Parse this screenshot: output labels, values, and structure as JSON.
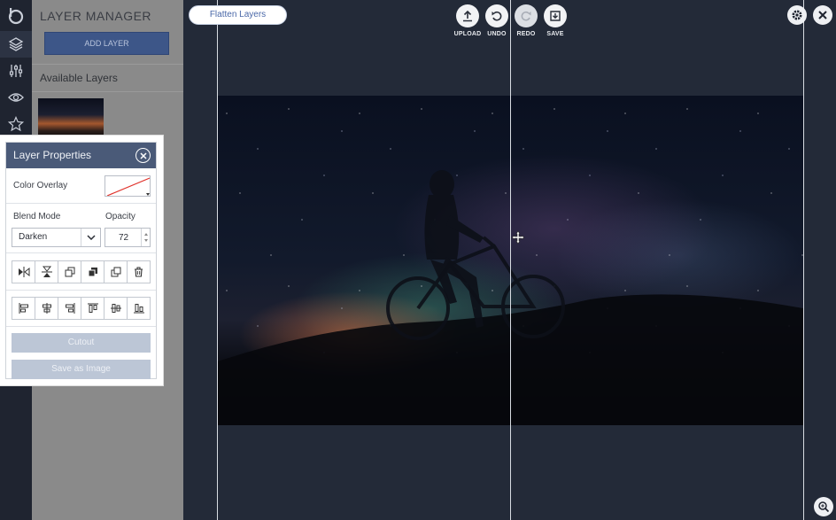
{
  "toolbar": {
    "flatten_label": "Flatten Layers",
    "upload_label": "UPLOAD",
    "undo_label": "UNDO",
    "redo_label": "REDO",
    "save_label": "SAVE"
  },
  "rail": {
    "icons": [
      "logo-icon",
      "layers-icon",
      "adjust-sliders-icon",
      "eye-icon",
      "star-icon"
    ]
  },
  "layer_manager": {
    "title": "LAYER MANAGER",
    "add_layer_label": "ADD LAYER",
    "available_label": "Available Layers"
  },
  "layer_properties": {
    "title": "Layer Properties",
    "color_overlay_label": "Color Overlay",
    "blend_mode_label": "Blend Mode",
    "blend_mode_value": "Darken",
    "opacity_label": "Opacity",
    "opacity_value": "72",
    "cutout_label": "Cutout",
    "save_image_label": "Save as Image"
  },
  "colors": {
    "accent": "#4a5a78",
    "add_layer_bg": "#3d5688",
    "panel_bg": "#8a8a8a",
    "workspace_bg": "#232a38",
    "disabled_btn": "#bcc6d6"
  }
}
